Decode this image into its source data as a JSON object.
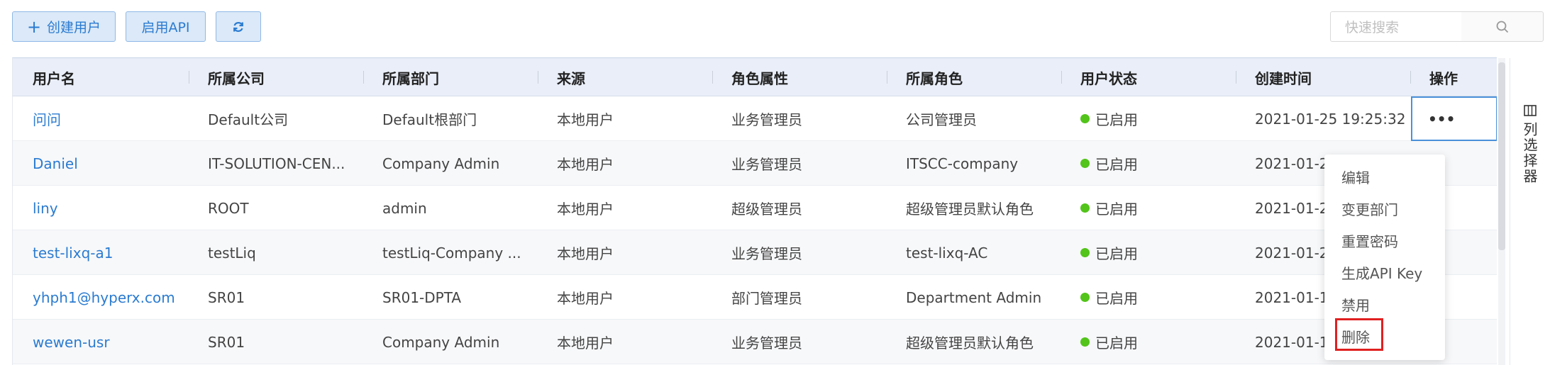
{
  "toolbar": {
    "create_user_label": "创建用户",
    "enable_api_label": "启用API",
    "refresh_icon": "refresh-icon",
    "search_placeholder": "快速搜索",
    "search_icon": "search-icon"
  },
  "table": {
    "columns": [
      "用户名",
      "所属公司",
      "所属部门",
      "来源",
      "角色属性",
      "所属角色",
      "用户状态",
      "创建时间",
      "操作"
    ],
    "rows": [
      {
        "username": "问问",
        "company": "Default公司",
        "department": "Default根部门",
        "source": "本地用户",
        "role_attr": "业务管理员",
        "role": "公司管理员",
        "status": "已启用",
        "created": "2021-01-25 19:25:32",
        "ops": "•••"
      },
      {
        "username": "Daniel",
        "company": "IT-SOLUTION-CEN...",
        "department": "Company Admin",
        "source": "本地用户",
        "role_attr": "业务管理员",
        "role": "ITSCC-company",
        "status": "已启用",
        "created": "2021-01-2"
      },
      {
        "username": "liny",
        "company": "ROOT",
        "department": "admin",
        "source": "本地用户",
        "role_attr": "超级管理员",
        "role": "超级管理员默认角色",
        "status": "已启用",
        "created": "2021-01-2"
      },
      {
        "username": "test-lixq-a1",
        "company": "testLiq",
        "department": "testLiq-Company ...",
        "source": "本地用户",
        "role_attr": "业务管理员",
        "role": "test-lixq-AC",
        "status": "已启用",
        "created": "2021-01-2"
      },
      {
        "username": "yhph1@hyperx.com",
        "company": "SR01",
        "department": "SR01-DPTA",
        "source": "本地用户",
        "role_attr": "部门管理员",
        "role": "Department Admin",
        "status": "已启用",
        "created": "2021-01-1"
      },
      {
        "username": "wewen-usr",
        "company": "SR01",
        "department": "Company Admin",
        "source": "本地用户",
        "role_attr": "业务管理员",
        "role": "超级管理员默认角色",
        "status": "已启用",
        "created": "2021-01-1"
      }
    ]
  },
  "column_selector": {
    "label": "列选择器",
    "icon": "columns-icon"
  },
  "dropdown": {
    "items": [
      "编辑",
      "变更部门",
      "重置密码",
      "生成API Key",
      "禁用",
      "删除"
    ],
    "highlighted": "删除"
  },
  "colors": {
    "accent": "#2b7bd0",
    "status_green": "#52c41a",
    "header_bg": "#e9eef8",
    "highlight_red": "#e02020"
  }
}
